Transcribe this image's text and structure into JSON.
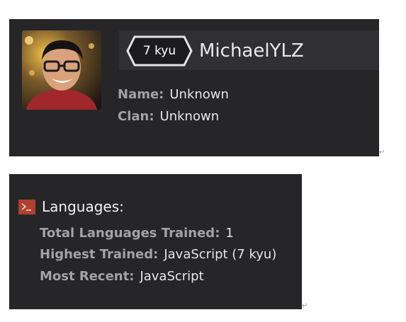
{
  "profile": {
    "rank": "7 kyu",
    "username": "MichaelYLZ",
    "name_label": "Name:",
    "name_value": "Unknown",
    "clan_label": "Clan:",
    "clan_value": "Unknown"
  },
  "languages": {
    "header": "Languages:",
    "total_label": "Total Languages Trained:",
    "total_value": "1",
    "highest_label": "Highest Trained:",
    "highest_value": "JavaScript (7 kyu)",
    "recent_label": "Most Recent:",
    "recent_value": "JavaScript"
  },
  "paragraph_mark": "↵",
  "colors": {
    "card_bg": "#262629",
    "banner_bg": "#303033",
    "badge_border": "#e5e5e5",
    "icon_accent": "#b0402f",
    "label": "#a3a3a3",
    "value": "#e6e6e6"
  },
  "icons": {
    "avatar": "profile-photo",
    "rank": "hexagon-rank-badge",
    "languages": "terminal-icon"
  }
}
